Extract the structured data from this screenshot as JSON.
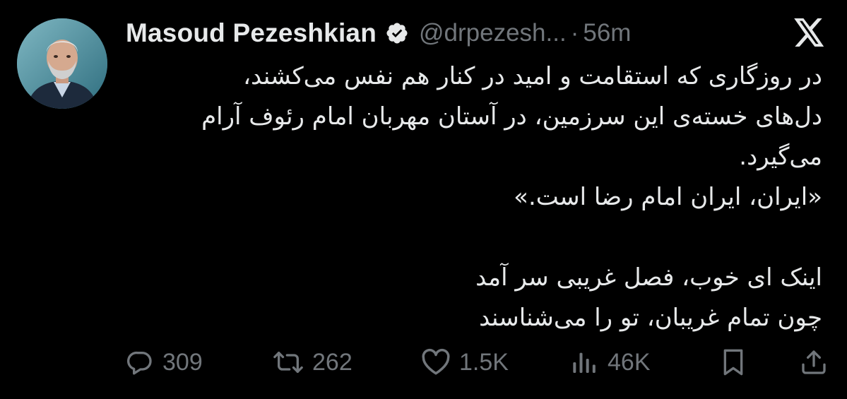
{
  "author": {
    "name": "Masoud Pezeshkian",
    "handle": "@drpezesh...",
    "separator": "·",
    "time": "56m",
    "verified": true
  },
  "tweet": {
    "lines": [
      "در روزگاری که استقامت و امید در کنار هم نفس می‌کشند،",
      "دل‌های خسته‌ی این سرزمین، در آستان مهربان امام رئوف آرام",
      "می‌گیرد.",
      "«ایران، ایران امام رضا است.»",
      "",
      "اینک ای خوب، فصل غریبی سر آمد",
      "چون تمام غریبان، تو را می‌شناسند"
    ]
  },
  "actions": {
    "replies": "309",
    "retweets": "262",
    "likes": "1.5K",
    "views": "46K"
  },
  "icons": {
    "brand": "x-logo-icon",
    "verified": "verified-badge-icon",
    "reply": "reply-icon",
    "retweet": "retweet-icon",
    "like": "heart-icon",
    "views": "views-icon",
    "bookmark": "bookmark-icon",
    "share": "share-icon"
  },
  "colors": {
    "background": "#000000",
    "text": "#e7e9ea",
    "muted": "#71767b"
  }
}
